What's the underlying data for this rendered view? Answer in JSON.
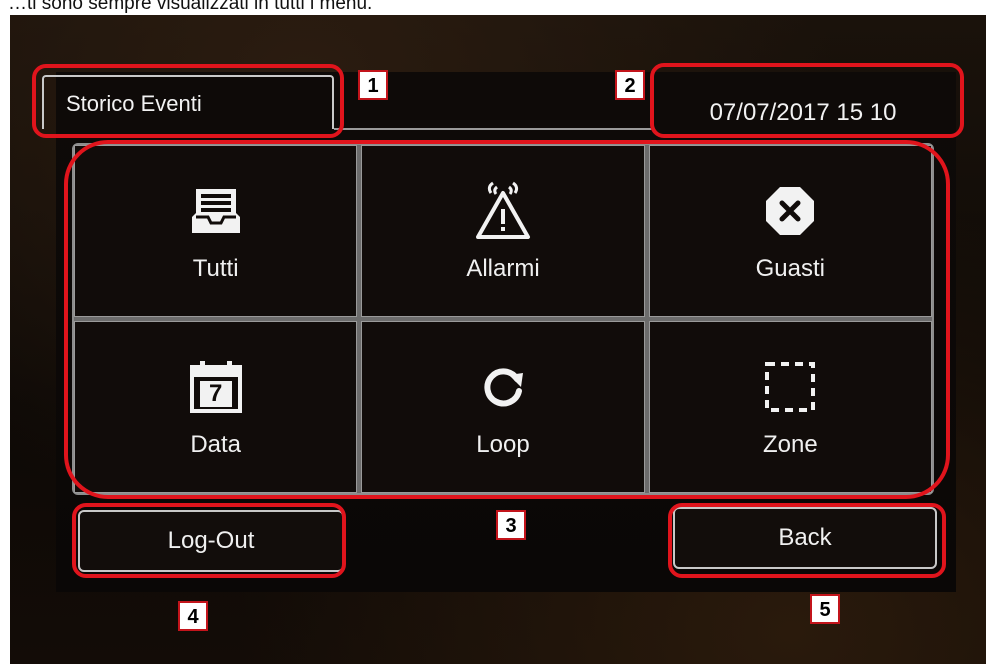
{
  "caption": "…ti sono sempre visualizzati in tutti i menu.",
  "screen": {
    "title": "Storico Eventi",
    "datetime": "07/07/2017 15 10"
  },
  "tiles": [
    {
      "label": "Tutti",
      "icon": "inbox-tray-icon"
    },
    {
      "label": "Allarmi",
      "icon": "alarm-triangle-icon"
    },
    {
      "label": "Guasti",
      "icon": "fault-octagon-icon"
    },
    {
      "label": "Data",
      "icon": "calendar-icon",
      "icon_text": "7"
    },
    {
      "label": "Loop",
      "icon": "refresh-icon"
    },
    {
      "label": "Zone",
      "icon": "dashed-square-icon"
    }
  ],
  "buttons": {
    "logout": "Log-Out",
    "back": "Back"
  },
  "callouts": [
    "1",
    "2",
    "3",
    "4",
    "5"
  ],
  "colors": {
    "highlight": "#e0141c",
    "screen_bg": "#0e0a08",
    "text": "#f0f0f0"
  }
}
